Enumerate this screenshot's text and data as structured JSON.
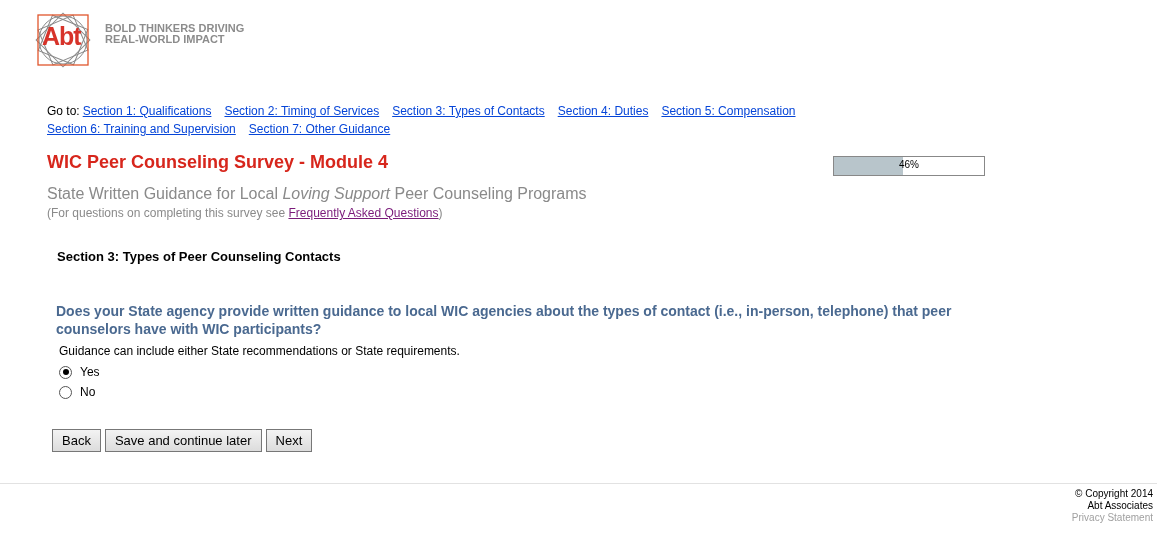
{
  "logo": {
    "mark": "Abt",
    "tagline": [
      "BOLD THINKERS DRIVING",
      "REAL-WORLD IMPACT"
    ]
  },
  "nav": {
    "label": "Go to:",
    "links": [
      {
        "label": "Section 1: Qualifications"
      },
      {
        "label": "Section 2: Timing of Services"
      },
      {
        "label": "Section 3: Types of Contacts"
      },
      {
        "label": "Section 4: Duties"
      },
      {
        "label": "Section 5: Compensation"
      },
      {
        "label": "Section 6: Training and Supervision"
      },
      {
        "label": "Section 7: Other Guidance"
      }
    ]
  },
  "title": "WIC Peer Counseling Survey - Module 4",
  "progress": {
    "level": 0.46,
    "reading": "46%"
  },
  "subtitle": "State Written Guidance for Local *Loving Support* Peer Counseling Programs",
  "help": {
    "before": "(For questions on completing this survey see ",
    "link": "Frequently Asked Questions",
    "after": ")"
  },
  "section_heading": "Section 3: Types of Peer Counseling Contacts",
  "question": "Does your State agency provide written guidance to local WIC agencies about the types of contact (i.e., in-person, telephone) that peer counselors have with WIC participants?",
  "hint": "Guidance can include either State recommendations or State requirements.",
  "options": [
    {
      "label": "Yes",
      "selected": true
    },
    {
      "label": "No",
      "selected": false
    }
  ],
  "buttons": [
    "Back",
    "Save and continue later",
    "Next"
  ],
  "footer": {
    "copyright": "© Copyright 2014",
    "company": "Abt Associates",
    "privacy": "Privacy Statement"
  }
}
